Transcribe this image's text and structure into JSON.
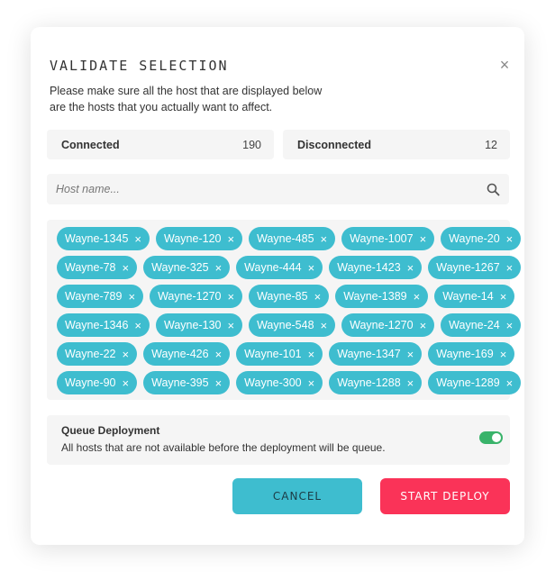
{
  "dialog": {
    "title": "VALIDATE SELECTION",
    "close_icon": "close-icon",
    "description_line1": "Please make sure all the host that are displayed below",
    "description_line2": "are the hosts that you actually want to affect."
  },
  "stats": {
    "connected_label": "Connected",
    "connected_value": "190",
    "disconnected_label": "Disconnected",
    "disconnected_value": "12"
  },
  "search": {
    "placeholder": "Host name...",
    "value": "",
    "icon": "search-icon"
  },
  "hosts": {
    "remove_glyph": "×",
    "rows": [
      [
        "Wayne-1345",
        "Wayne-120",
        "Wayne-485",
        "Wayne-1007",
        "Wayne-20"
      ],
      [
        "Wayne-78",
        "Wayne-325",
        "Wayne-444",
        "Wayne-1423",
        "Wayne-1267"
      ],
      [
        "Wayne-789",
        "Wayne-1270",
        "Wayne-85",
        "Wayne-1389",
        "Wayne-14"
      ],
      [
        "Wayne-1346",
        "Wayne-130",
        "Wayne-548",
        "Wayne-1270",
        "Wayne-24"
      ],
      [
        "Wayne-22",
        "Wayne-426",
        "Wayne-101",
        "Wayne-1347",
        "Wayne-169"
      ],
      [
        "Wayne-90",
        "Wayne-395",
        "Wayne-300",
        "Wayne-1288",
        "Wayne-1289"
      ]
    ]
  },
  "queue": {
    "title": "Queue Deployment",
    "description": "All hosts that are not available before the deployment will be queue.",
    "enabled": true
  },
  "actions": {
    "cancel": "CANCEL",
    "start_deploy": "START DEPLOY"
  },
  "colors": {
    "chip": "#3ebdcf",
    "cancel": "#3ebdcf",
    "start_deploy": "#fa3358",
    "toggle_on": "#39b36a"
  }
}
